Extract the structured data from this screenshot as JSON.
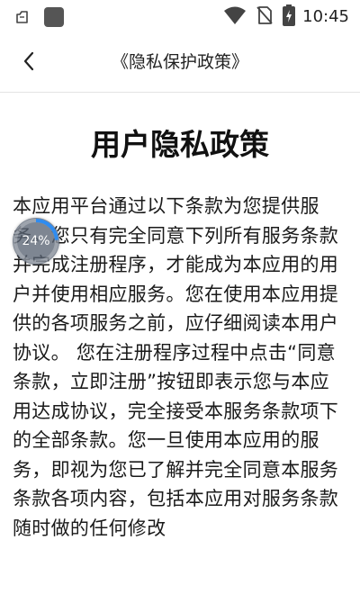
{
  "status_bar": {
    "time": "10:45",
    "icons": [
      "notification-icon",
      "app-square-icon",
      "wifi-icon",
      "no-sim-icon",
      "battery-charging-icon"
    ]
  },
  "header": {
    "back_icon": "chevron-left-icon",
    "title": "《隐私保护政策》"
  },
  "document": {
    "title": "用户隐私政策",
    "body": "本应用平台通过以下条款为您提供服务。您只有完全同意下列所有服务条款并完成注册程序，才能成为本应用的用户并使用相应服务。您在使用本应用提供的各项服务之前，应仔细阅读本用户协议。 您在注册程序过程中点击“同意条款，立即注册”按钮即表示您与本应用达成协议，完全接受本服务条款项下的全部条款。您一旦使用本应用的服务，即视为您已了解并完全同意本服务条款各项内容，包括本应用对服务条款随时做的任何修改"
  },
  "progress": {
    "label": "24%",
    "value": 0.24,
    "color": "#2f8cf0"
  }
}
